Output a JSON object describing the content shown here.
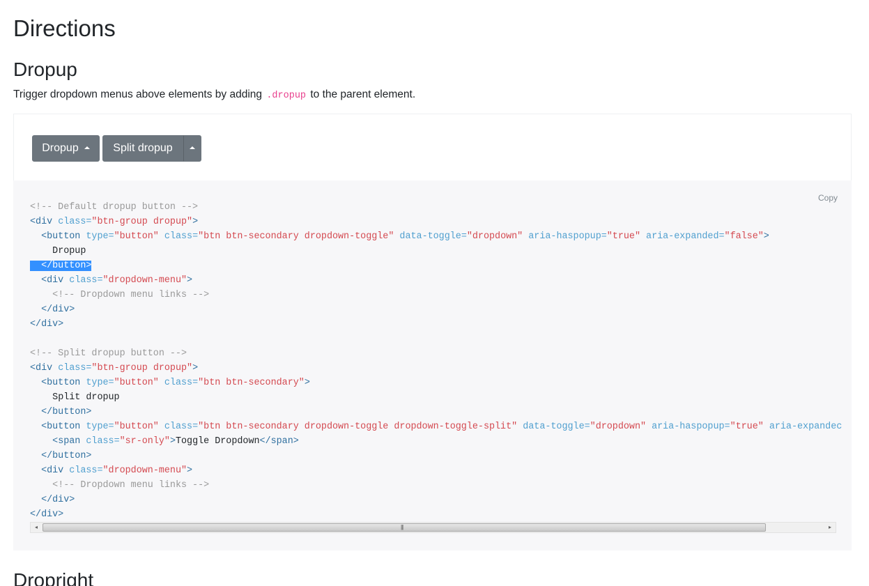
{
  "page": {
    "title": "Directions",
    "section_title": "Dropup",
    "next_section_title": "Dropright",
    "intro_before": "Trigger dropdown menus above elements by adding ",
    "intro_code": ".dropup",
    "intro_after": " to the parent element."
  },
  "example": {
    "dropup_label": "Dropup",
    "split_label": "Split dropup"
  },
  "code": {
    "copy_label": "Copy",
    "comment_default": "<!-- Default dropup button -->",
    "comment_split": "<!-- Split dropup button -->",
    "comment_menu": "<!-- Dropdown menu links -->",
    "text_dropup": "Dropup",
    "text_split": "Split dropup",
    "text_toggle": "Toggle Dropdown",
    "tag_div_open": "<div",
    "tag_div_close": "</div>",
    "tag_button_open": "<button",
    "tag_button_close": "</button>",
    "tag_span_open": "<span",
    "tag_span_close": "</span>",
    "gt": ">",
    "attr_class": "class=",
    "attr_type": "type=",
    "attr_toggle": "data-toggle=",
    "attr_haspopup": "aria-haspopup=",
    "attr_expanded": "aria-expanded=",
    "attr_expanded_cut": "aria-expandec",
    "str_btn_group": "\"btn-group dropup\"",
    "str_button": "\"button\"",
    "str_btn_toggle": "\"btn btn-secondary dropdown-toggle\"",
    "str_btn_secondary": "\"btn btn-secondary\"",
    "str_btn_split": "\"btn btn-secondary dropdown-toggle dropdown-toggle-split\"",
    "str_dropdown": "\"dropdown\"",
    "str_true": "\"true\"",
    "str_false": "\"false\"",
    "str_menu": "\"dropdown-menu\"",
    "str_sr_only": "\"sr-only\""
  },
  "scrollbar": {
    "left_arrow": "◂",
    "right_arrow": "▸",
    "grip": "|||"
  }
}
